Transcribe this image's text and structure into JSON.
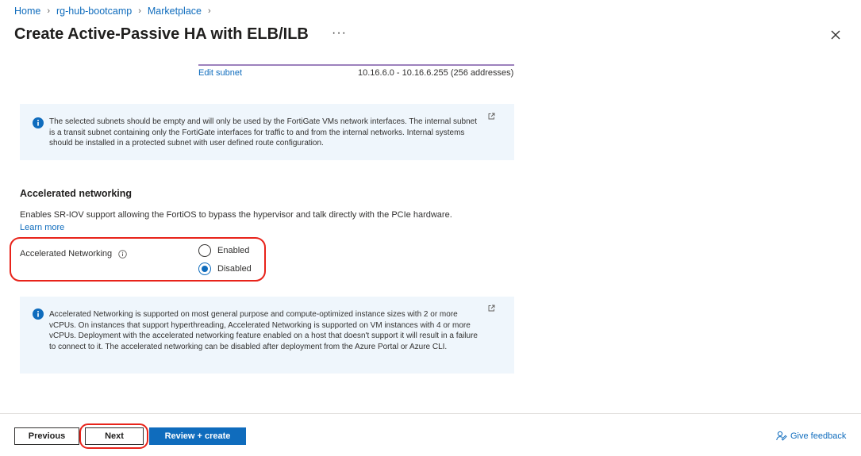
{
  "breadcrumb": [
    {
      "label": "Home"
    },
    {
      "label": "rg-hub-bootcamp"
    },
    {
      "label": "Marketplace"
    }
  ],
  "header": {
    "title": "Create Active-Passive HA with ELB/ILB",
    "more_label": "···"
  },
  "subnet": {
    "edit_label": "Edit subnet",
    "range": "10.16.6.0 - 10.16.6.255 (256 addresses)"
  },
  "info_subnets": {
    "text": "The selected subnets should be empty and will only be used by the FortiGate VMs network interfaces. The internal subnet is a transit subnet containing only the FortiGate interfaces for traffic to and from the internal networks. Internal systems should be installed in a protected subnet with user defined route configuration."
  },
  "accelerated": {
    "heading": "Accelerated networking",
    "description": "Enables SR-IOV support allowing the FortiOS to bypass the hypervisor and talk directly with the PCIe hardware.",
    "learn_more": "Learn more",
    "field_label": "Accelerated Networking",
    "options": [
      {
        "label": "Enabled",
        "checked": false
      },
      {
        "label": "Disabled",
        "checked": true
      }
    ]
  },
  "info_accelerated": {
    "text": "Accelerated Networking is supported on most general purpose and compute-optimized instance sizes with 2 or more vCPUs. On instances that support hyperthreading, Accelerated Networking is supported on VM instances with 4 or more vCPUs. Deployment with the accelerated networking feature enabled on a host that doesn't support it will result in a failure to connect to it. The accelerated networking can be disabled after deployment from the Azure Portal or Azure CLI."
  },
  "footer": {
    "previous_label": "Previous",
    "next_label": "Next",
    "review_label": "Review + create",
    "feedback_label": "Give feedback"
  },
  "colors": {
    "accent": "#0f6cbd",
    "info_background": "#eff6fc",
    "highlight": "#e8231a"
  }
}
